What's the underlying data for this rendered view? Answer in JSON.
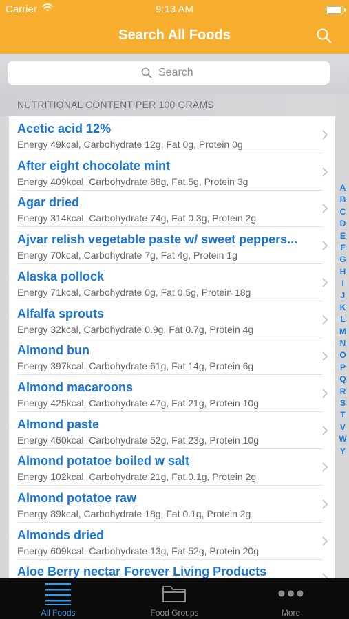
{
  "status": {
    "carrier": "Carrier",
    "time": "9:13 AM"
  },
  "nav": {
    "title": "Search All Foods"
  },
  "search": {
    "placeholder": "Search"
  },
  "section_header": "NUTRITIONAL CONTENT PER 100 GRAMS",
  "foods": [
    {
      "name": "Acetic acid 12%",
      "desc": "Energy 49kcal, Carbohydrate 12g, Fat 0g, Protein 0g"
    },
    {
      "name": "After eight chocolate mint",
      "desc": "Energy 409kcal, Carbohydrate 88g, Fat 5g, Protein 3g"
    },
    {
      "name": "Agar dried",
      "desc": "Energy 314kcal, Carbohydrate 74g, Fat 0.3g, Protein 2g"
    },
    {
      "name": "Ajvar relish vegetable paste w/ sweet peppers...",
      "desc": "Energy 70kcal, Carbohydrate 7g, Fat 4g, Protein 1g"
    },
    {
      "name": "Alaska pollock",
      "desc": "Energy 71kcal, Carbohydrate 0g, Fat 0.5g, Protein 18g"
    },
    {
      "name": "Alfalfa sprouts",
      "desc": "Energy 32kcal, Carbohydrate 0.9g, Fat 0.7g, Protein 4g"
    },
    {
      "name": "Almond bun",
      "desc": "Energy 397kcal, Carbohydrate 61g, Fat 14g, Protein 6g"
    },
    {
      "name": "Almond macaroons",
      "desc": "Energy 425kcal, Carbohydrate 47g, Fat 21g, Protein 10g"
    },
    {
      "name": "Almond paste",
      "desc": "Energy 460kcal, Carbohydrate 52g, Fat 23g, Protein 10g"
    },
    {
      "name": "Almond potatoe boiled w salt",
      "desc": "Energy 102kcal, Carbohydrate 21g, Fat 0.1g, Protein 2g"
    },
    {
      "name": "Almond potatoe raw",
      "desc": "Energy 89kcal, Carbohydrate 18g, Fat 0.1g, Protein 2g"
    },
    {
      "name": "Almonds dried",
      "desc": "Energy 609kcal, Carbohydrate 13g, Fat 52g, Protein 20g"
    },
    {
      "name": "Aloe Berry nectar Forever Living Products",
      "desc": ""
    }
  ],
  "index_letters": [
    "A",
    "B",
    "C",
    "D",
    "E",
    "F",
    "G",
    "H",
    "I",
    "J",
    "K",
    "L",
    "M",
    "N",
    "O",
    "P",
    "Q",
    "R",
    "S",
    "T",
    "V",
    "W",
    "Y"
  ],
  "tabs": [
    {
      "label": "All Foods",
      "icon": "list-icon",
      "active": true
    },
    {
      "label": "Food Groups",
      "icon": "folder-icon",
      "active": false
    },
    {
      "label": "More",
      "icon": "more-icon",
      "active": false
    }
  ],
  "colors": {
    "accent": "#f8ae2f",
    "link": "#1a74d7",
    "tab_active": "#3a9ae8"
  }
}
